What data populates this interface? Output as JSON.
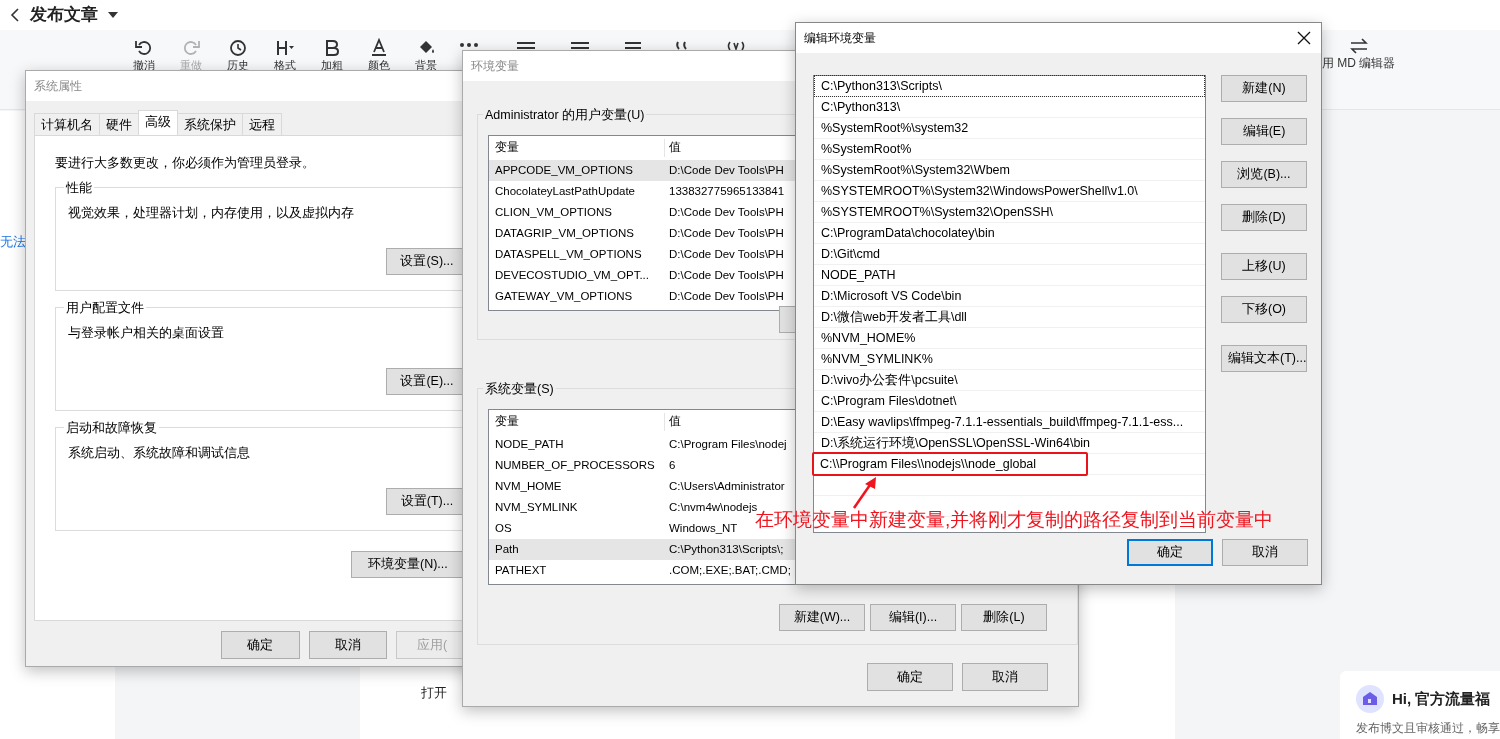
{
  "app": {
    "title": "发布文章",
    "toolbar": [
      {
        "kind": "undo",
        "label": "撤消",
        "disabled": false
      },
      {
        "kind": "redo",
        "label": "重做",
        "disabled": true
      },
      {
        "kind": "history",
        "label": "历史",
        "disabled": false
      },
      {
        "kind": "heading",
        "label": "格式",
        "disabled": false
      },
      {
        "kind": "bold",
        "label": "加粗",
        "disabled": false
      },
      {
        "kind": "color",
        "label": "颜色",
        "disabled": false
      },
      {
        "kind": "background",
        "label": "背景",
        "disabled": false
      }
    ],
    "md_switch": "用 MD 编辑器",
    "side_link": "无法",
    "editor_hint": "打开",
    "promo": {
      "title": "Hi, 官方流量福",
      "text": "发布博文且审核通过，畅享"
    }
  },
  "system_properties": {
    "title": "系统属性",
    "tabs": [
      {
        "label": "计算机名",
        "selected": false
      },
      {
        "label": "硬件",
        "selected": false
      },
      {
        "label": "高级",
        "selected": true
      },
      {
        "label": "系统保护",
        "selected": false
      },
      {
        "label": "远程",
        "selected": false
      }
    ],
    "notice": "要进行大多数更改，你必须作为管理员登录。",
    "groups": [
      {
        "title": "性能",
        "description": "视觉效果，处理器计划，内存使用，以及虚拟内存",
        "button": "设置(S)..."
      },
      {
        "title": "用户配置文件",
        "description": "与登录帐户相关的桌面设置",
        "button": "设置(E)..."
      },
      {
        "title": "启动和故障恢复",
        "description": "系统启动、系统故障和调试信息",
        "button": "设置(T)..."
      }
    ],
    "env_button": "环境变量(N)...",
    "buttons": [
      {
        "label": "确定",
        "disabled": false
      },
      {
        "label": "取消",
        "disabled": false
      },
      {
        "label": "应用(",
        "disabled": true
      }
    ]
  },
  "environment_variables": {
    "title": "环境变量",
    "user_group": "Administrator 的用户变量(U)",
    "user_table": {
      "columns": [
        "变量",
        "值"
      ],
      "rows": [
        {
          "name": "APPCODE_VM_OPTIONS",
          "value": "D:\\Code Dev Tools\\PH",
          "selected": true
        },
        {
          "name": "ChocolateyLastPathUpdate",
          "value": "133832775965133841",
          "selected": false
        },
        {
          "name": "CLION_VM_OPTIONS",
          "value": "D:\\Code Dev Tools\\PH",
          "selected": false
        },
        {
          "name": "DATAGRIP_VM_OPTIONS",
          "value": "D:\\Code Dev Tools\\PH",
          "selected": false
        },
        {
          "name": "DATASPELL_VM_OPTIONS",
          "value": "D:\\Code Dev Tools\\PH",
          "selected": false
        },
        {
          "name": "DEVECOSTUDIO_VM_OPT...",
          "value": "D:\\Code Dev Tools\\PH",
          "selected": false
        },
        {
          "name": "GATEWAY_VM_OPTIONS",
          "value": "D:\\Code Dev Tools\\PH",
          "selected": false
        }
      ]
    },
    "system_group": "系统变量(S)",
    "system_table": {
      "columns": [
        "变量",
        "值"
      ],
      "rows": [
        {
          "name": "NODE_PATH",
          "value": "C:\\Program Files\\nodej",
          "selected": false
        },
        {
          "name": "NUMBER_OF_PROCESSORS",
          "value": "6",
          "selected": false
        },
        {
          "name": "NVM_HOME",
          "value": "C:\\Users\\Administrator",
          "selected": false
        },
        {
          "name": "NVM_SYMLINK",
          "value": "C:\\nvm4w\\nodejs",
          "selected": false
        },
        {
          "name": "OS",
          "value": "Windows_NT",
          "selected": false
        },
        {
          "name": "Path",
          "value": "C:\\Python313\\Scripts\\;",
          "selected": true
        },
        {
          "name": "PATHEXT",
          "value": ".COM;.EXE;.BAT;.CMD;",
          "selected": false
        }
      ]
    },
    "system_buttons": [
      "新建(W)...",
      "编辑(I)...",
      "删除(L)"
    ],
    "buttons": [
      "确定",
      "取消"
    ]
  },
  "edit_dialog": {
    "title": "编辑环境变量",
    "entries": [
      {
        "text": "C:\\Python313\\Scripts\\",
        "focused": true,
        "highlighted": false
      },
      {
        "text": "C:\\Python313\\",
        "focused": false,
        "highlighted": false
      },
      {
        "text": "%SystemRoot%\\system32",
        "focused": false,
        "highlighted": false
      },
      {
        "text": "%SystemRoot%",
        "focused": false,
        "highlighted": false
      },
      {
        "text": "%SystemRoot%\\System32\\Wbem",
        "focused": false,
        "highlighted": false
      },
      {
        "text": "%SYSTEMROOT%\\System32\\WindowsPowerShell\\v1.0\\",
        "focused": false,
        "highlighted": false
      },
      {
        "text": "%SYSTEMROOT%\\System32\\OpenSSH\\",
        "focused": false,
        "highlighted": false
      },
      {
        "text": "C:\\ProgramData\\chocolatey\\bin",
        "focused": false,
        "highlighted": false
      },
      {
        "text": "D:\\Git\\cmd",
        "focused": false,
        "highlighted": false
      },
      {
        "text": "NODE_PATH",
        "focused": false,
        "highlighted": false
      },
      {
        "text": "D:\\Microsoft VS Code\\bin",
        "focused": false,
        "highlighted": false
      },
      {
        "text": "D:\\微信web开发者工具\\dll",
        "focused": false,
        "highlighted": false
      },
      {
        "text": "%NVM_HOME%",
        "focused": false,
        "highlighted": false
      },
      {
        "text": "%NVM_SYMLINK%",
        "focused": false,
        "highlighted": false
      },
      {
        "text": "D:\\vivo办公套件\\pcsuite\\",
        "focused": false,
        "highlighted": false
      },
      {
        "text": "C:\\Program Files\\dotnet\\",
        "focused": false,
        "highlighted": false
      },
      {
        "text": "D:\\Easy wavlips\\ffmpeg-7.1.1-essentials_build\\ffmpeg-7.1.1-ess...",
        "focused": false,
        "highlighted": false
      },
      {
        "text": "D:\\系统运行环境\\OpenSSL\\OpenSSL-Win64\\bin",
        "focused": false,
        "highlighted": false
      },
      {
        "text": "C:\\\\Program Files\\\\nodejs\\\\node_global",
        "focused": false,
        "highlighted": true
      }
    ],
    "button_groups": [
      [
        "新建(N)",
        "编辑(E)",
        "浏览(B)...",
        "删除(D)"
      ],
      [
        "上移(U)",
        "下移(O)"
      ],
      [
        "编辑文本(T)..."
      ]
    ],
    "footer_buttons": [
      {
        "label": "确定",
        "default": true
      },
      {
        "label": "取消",
        "default": false
      }
    ]
  },
  "annotation": {
    "text": "在环境变量中新建变量,并将刚才复制的路径复制到当前变量中"
  }
}
